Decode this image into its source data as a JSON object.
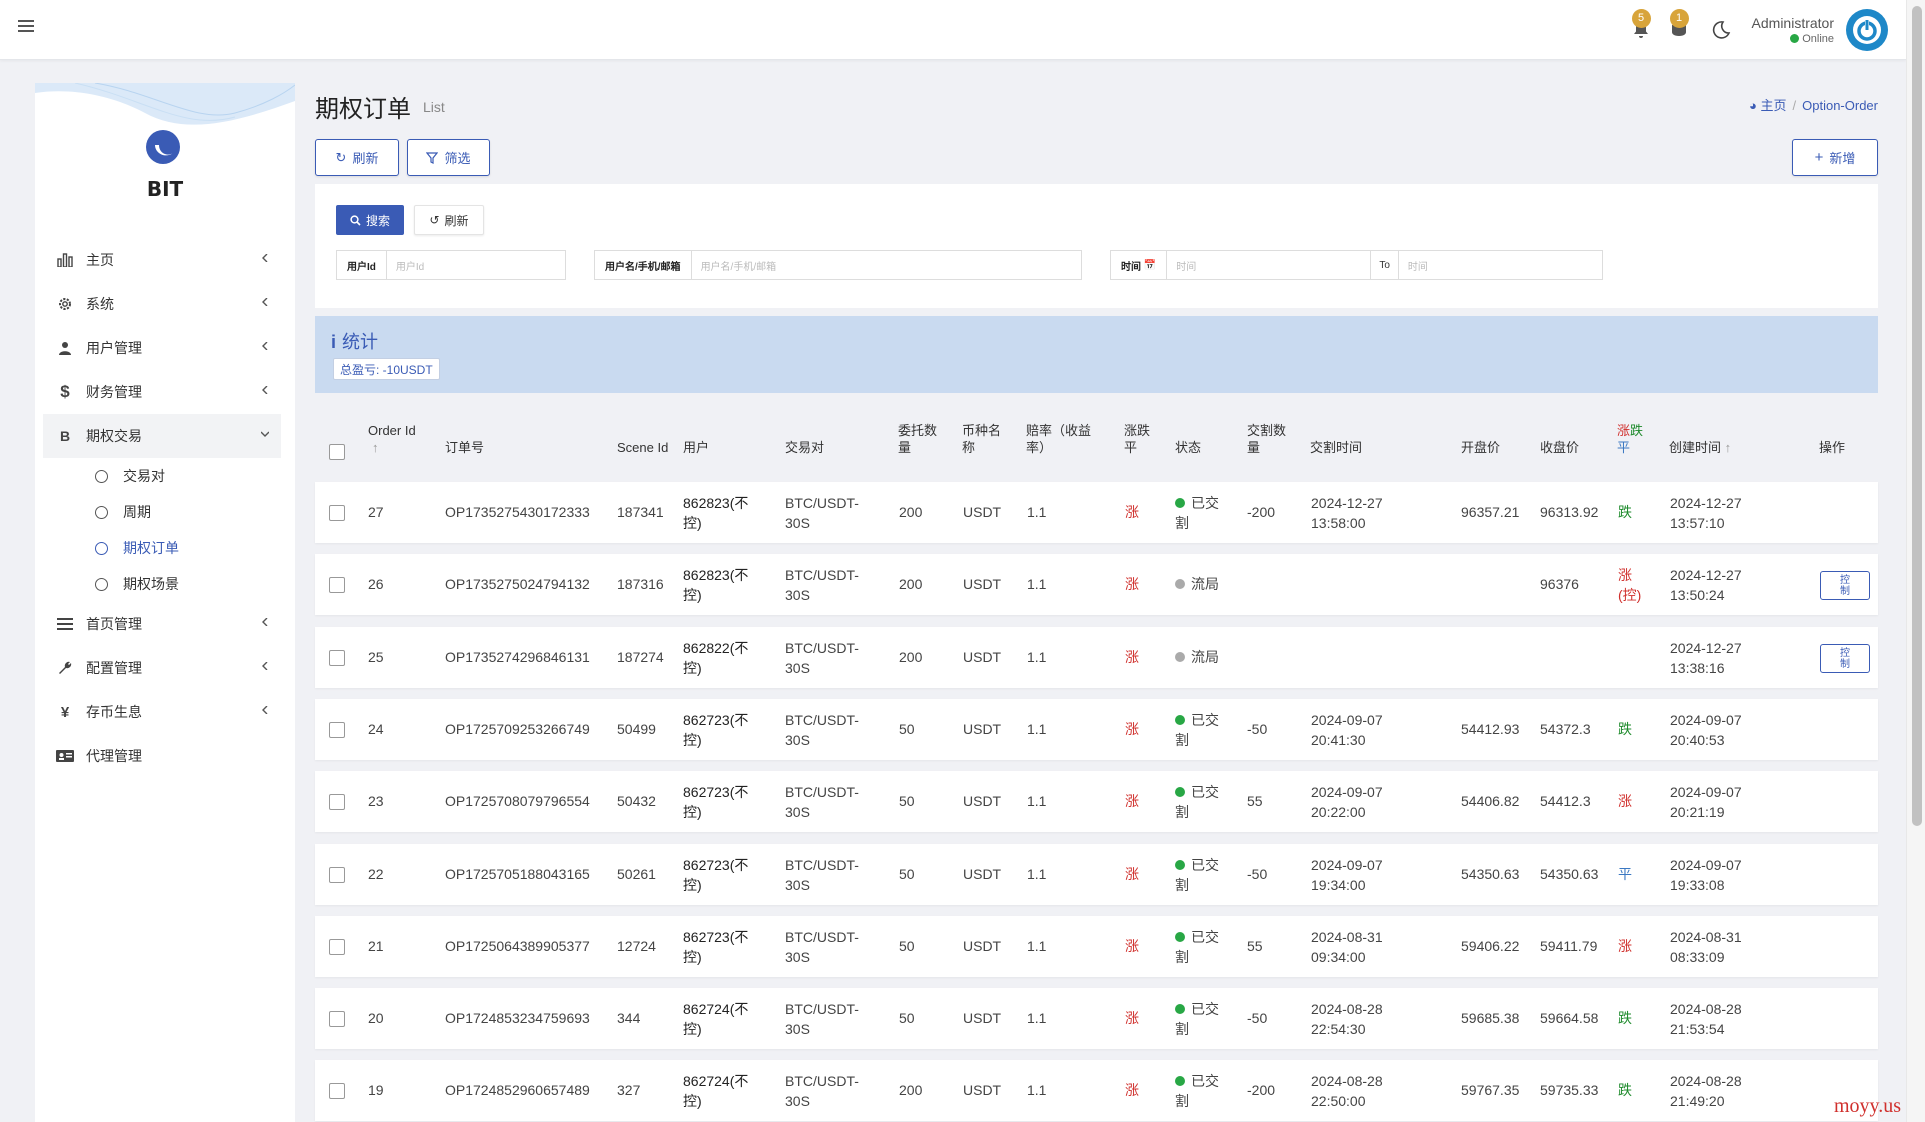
{
  "topbar": {
    "notif_bell_count": "5",
    "notif_msg_count": "1",
    "user_name": "Administrator",
    "user_status": "Online"
  },
  "sidebar": {
    "logo_text": "BIT",
    "items": [
      {
        "label": "主页",
        "icon": "bar-chart-icon"
      },
      {
        "label": "系统",
        "icon": "gear-icon"
      },
      {
        "label": "用户管理",
        "icon": "users-icon"
      },
      {
        "label": "财务管理",
        "icon": "dollar-icon"
      },
      {
        "label": "期权交易",
        "icon": "bitcoin-icon"
      }
    ],
    "sub_items": [
      {
        "label": "交易对"
      },
      {
        "label": "周期"
      },
      {
        "label": "期权订单"
      },
      {
        "label": "期权场景"
      }
    ],
    "items_after": [
      {
        "label": "首页管理",
        "icon": "list-icon"
      },
      {
        "label": "配置管理",
        "icon": "wrench-icon"
      },
      {
        "label": "存币生息",
        "icon": "yen-icon"
      },
      {
        "label": "代理管理",
        "icon": "id-card-icon"
      }
    ]
  },
  "page": {
    "title": "期权订单",
    "subtitle": "List",
    "breadcrumb_home": "主页",
    "breadcrumb_current": "Option-Order",
    "refresh_label": "刷新",
    "filter_label": "筛选",
    "add_label": "新增"
  },
  "filters": {
    "search_label": "搜索",
    "reset_label": "刷新",
    "user_id_label": "用户Id",
    "user_id_placeholder": "用户Id",
    "username_label": "用户名/手机/邮箱",
    "username_placeholder": "用户名/手机/邮箱",
    "time_label": "时间",
    "time_from_placeholder": "时间",
    "to_label": "To",
    "time_to_placeholder": "时间"
  },
  "stats": {
    "title": "统计",
    "total_pnl": "总盈亏: -10USDT"
  },
  "table": {
    "headers": {
      "order_id": "Order Id",
      "order_no": "订单号",
      "scene_id": "Scene Id",
      "user": "用户",
      "pair": "交易对",
      "amount_1": "委托数",
      "amount_2": "量",
      "coin_1": "币种名",
      "coin_2": "称",
      "rate_1": "赔率（收益",
      "rate_2": "率）",
      "direction_1": "涨跌",
      "direction_2": "平",
      "status": "状态",
      "settle_qty_1": "交割数",
      "settle_qty_2": "量",
      "settle_time": "交割时间",
      "open_price": "开盘价",
      "close_price": "收盘价",
      "result_up": "涨",
      "result_down": "跌",
      "result_flat": "平",
      "created_at": "创建时间",
      "actions": "操作"
    },
    "control_label_1": "控",
    "control_label_2": "制",
    "rows": [
      {
        "id": "27",
        "order_no": "OP1735275430172333",
        "scene": "187341",
        "user_1": "862823(不",
        "user_2": "控)",
        "pair_1": "BTC/USDT-",
        "pair_2": "30S",
        "amount": "200",
        "coin": "USDT",
        "rate": "1.1",
        "dir": "涨",
        "status_1": "已交",
        "status_2": "割",
        "status_type": "settled",
        "settle_qty": "-200",
        "settle_1": "2024-12-27",
        "settle_2": "13:58:00",
        "open": "96357.21",
        "close": "96313.92",
        "result_1": "跌",
        "result_2": "",
        "result_color": "green",
        "created_1": "2024-12-27",
        "created_2": "13:57:10",
        "has_control": false
      },
      {
        "id": "26",
        "order_no": "OP1735275024794132",
        "scene": "187316",
        "user_1": "862823(不",
        "user_2": "控)",
        "pair_1": "BTC/USDT-",
        "pair_2": "30S",
        "amount": "200",
        "coin": "USDT",
        "rate": "1.1",
        "dir": "涨",
        "status_1": "流局",
        "status_2": "",
        "status_type": "void",
        "settle_qty": "",
        "settle_1": "",
        "settle_2": "",
        "open": "",
        "close": "96376",
        "result_1": "涨",
        "result_2": "(控)",
        "result_color": "red",
        "created_1": "2024-12-27",
        "created_2": "13:50:24",
        "has_control": true
      },
      {
        "id": "25",
        "order_no": "OP1735274296846131",
        "scene": "187274",
        "user_1": "862822(不",
        "user_2": "控)",
        "pair_1": "BTC/USDT-",
        "pair_2": "30S",
        "amount": "200",
        "coin": "USDT",
        "rate": "1.1",
        "dir": "涨",
        "status_1": "流局",
        "status_2": "",
        "status_type": "void",
        "settle_qty": "",
        "settle_1": "",
        "settle_2": "",
        "open": "",
        "close": "",
        "result_1": "",
        "result_2": "",
        "result_color": "red",
        "created_1": "2024-12-27",
        "created_2": "13:38:16",
        "has_control": true
      },
      {
        "id": "24",
        "order_no": "OP1725709253266749",
        "scene": "50499",
        "user_1": "862723(不",
        "user_2": "控)",
        "pair_1": "BTC/USDT-",
        "pair_2": "30S",
        "amount": "50",
        "coin": "USDT",
        "rate": "1.1",
        "dir": "涨",
        "status_1": "已交",
        "status_2": "割",
        "status_type": "settled",
        "settle_qty": "-50",
        "settle_1": "2024-09-07",
        "settle_2": "20:41:30",
        "open": "54412.93",
        "close": "54372.3",
        "result_1": "跌",
        "result_2": "",
        "result_color": "green",
        "created_1": "2024-09-07",
        "created_2": "20:40:53",
        "has_control": false
      },
      {
        "id": "23",
        "order_no": "OP1725708079796554",
        "scene": "50432",
        "user_1": "862723(不",
        "user_2": "控)",
        "pair_1": "BTC/USDT-",
        "pair_2": "30S",
        "amount": "50",
        "coin": "USDT",
        "rate": "1.1",
        "dir": "涨",
        "status_1": "已交",
        "status_2": "割",
        "status_type": "settled",
        "settle_qty": "55",
        "settle_1": "2024-09-07",
        "settle_2": "20:22:00",
        "open": "54406.82",
        "close": "54412.3",
        "result_1": "涨",
        "result_2": "",
        "result_color": "red",
        "created_1": "2024-09-07",
        "created_2": "20:21:19",
        "has_control": false
      },
      {
        "id": "22",
        "order_no": "OP1725705188043165",
        "scene": "50261",
        "user_1": "862723(不",
        "user_2": "控)",
        "pair_1": "BTC/USDT-",
        "pair_2": "30S",
        "amount": "50",
        "coin": "USDT",
        "rate": "1.1",
        "dir": "涨",
        "status_1": "已交",
        "status_2": "割",
        "status_type": "settled",
        "settle_qty": "-50",
        "settle_1": "2024-09-07",
        "settle_2": "19:34:00",
        "open": "54350.63",
        "close": "54350.63",
        "result_1": "平",
        "result_2": "",
        "result_color": "blue",
        "created_1": "2024-09-07",
        "created_2": "19:33:08",
        "has_control": false
      },
      {
        "id": "21",
        "order_no": "OP1725064389905377",
        "scene": "12724",
        "user_1": "862723(不",
        "user_2": "控)",
        "pair_1": "BTC/USDT-",
        "pair_2": "30S",
        "amount": "50",
        "coin": "USDT",
        "rate": "1.1",
        "dir": "涨",
        "status_1": "已交",
        "status_2": "割",
        "status_type": "settled",
        "settle_qty": "55",
        "settle_1": "2024-08-31",
        "settle_2": "09:34:00",
        "open": "59406.22",
        "close": "59411.79",
        "result_1": "涨",
        "result_2": "",
        "result_color": "red",
        "created_1": "2024-08-31",
        "created_2": "08:33:09",
        "has_control": false
      },
      {
        "id": "20",
        "order_no": "OP1724853234759693",
        "scene": "344",
        "user_1": "862724(不",
        "user_2": "控)",
        "pair_1": "BTC/USDT-",
        "pair_2": "30S",
        "amount": "50",
        "coin": "USDT",
        "rate": "1.1",
        "dir": "涨",
        "status_1": "已交",
        "status_2": "割",
        "status_type": "settled",
        "settle_qty": "-50",
        "settle_1": "2024-08-28",
        "settle_2": "22:54:30",
        "open": "59685.38",
        "close": "59664.58",
        "result_1": "跌",
        "result_2": "",
        "result_color": "green",
        "created_1": "2024-08-28",
        "created_2": "21:53:54",
        "has_control": false
      },
      {
        "id": "19",
        "order_no": "OP1724852960657489",
        "scene": "327",
        "user_1": "862724(不",
        "user_2": "控)",
        "pair_1": "BTC/USDT-",
        "pair_2": "30S",
        "amount": "200",
        "coin": "USDT",
        "rate": "1.1",
        "dir": "涨",
        "status_1": "已交",
        "status_2": "割",
        "status_type": "settled",
        "settle_qty": "-200",
        "settle_1": "2024-08-28",
        "settle_2": "22:50:00",
        "open": "59767.35",
        "close": "59735.33",
        "result_1": "跌",
        "result_2": "",
        "result_color": "green",
        "created_1": "2024-08-28",
        "created_2": "21:49:20",
        "has_control": false
      }
    ]
  },
  "watermark": "moyy.us"
}
